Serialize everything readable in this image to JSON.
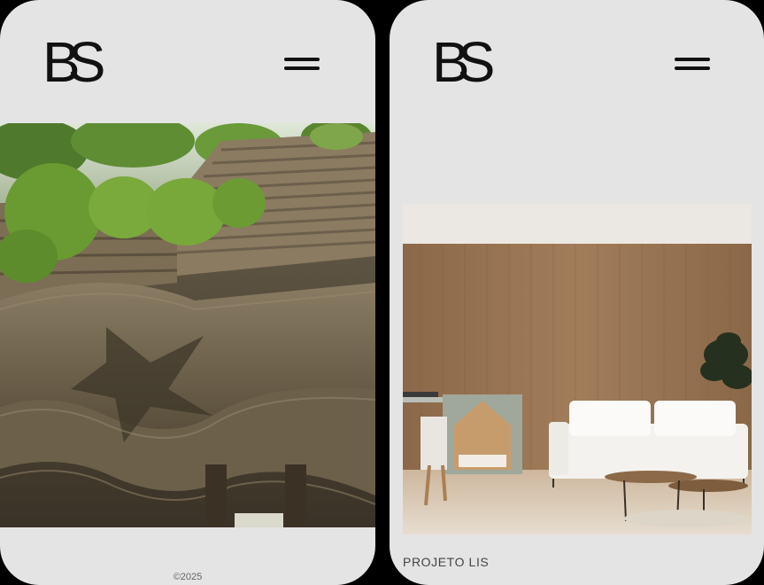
{
  "left_screen": {
    "logo": "BS",
    "menu_icon": "hamburger-icon",
    "hero_image": "green-building-architecture-photo",
    "footer": {
      "copyright": "©2025"
    }
  },
  "right_screen": {
    "logo": "BS",
    "menu_icon": "hamburger-icon",
    "project_image": "living-room-interior-photo",
    "project_caption": "PROJETO LIS"
  },
  "colors": {
    "page_bg": "#e4e4e4",
    "text": "#111111",
    "frame": "#000000"
  }
}
